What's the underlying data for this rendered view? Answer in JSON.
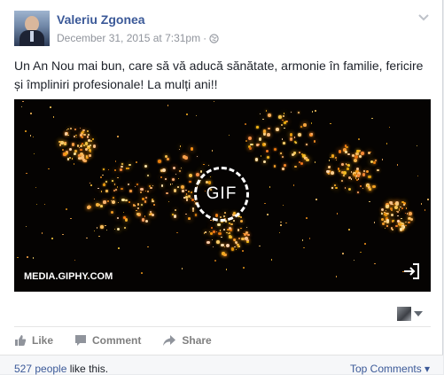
{
  "post": {
    "author": "Valeriu Zgonea",
    "timestamp": "December 31, 2015 at 7:31pm",
    "separator": "·",
    "privacy_icon": "globe-icon",
    "text": "Un An Nou mai bun, care să vă aducă sănătate, armonie în familie, fericire și împliniri profesionale! La mulți ani!!"
  },
  "media": {
    "badge": "GIF",
    "source": "MEDIA.GIPHY.COM",
    "share_icon": "share-out-icon"
  },
  "actions": {
    "like": "Like",
    "comment": "Comment",
    "share": "Share"
  },
  "footer": {
    "likes_count": "527 people",
    "likes_suffix": " like this.",
    "top_comments": "Top Comments",
    "top_comments_arrow": "▾"
  },
  "colors": {
    "link": "#3b5998",
    "muted": "#90949c",
    "action": "#7f7f7f"
  }
}
